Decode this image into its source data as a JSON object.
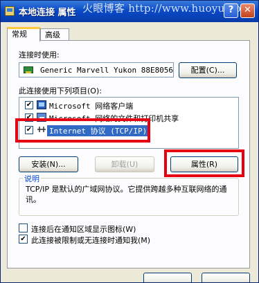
{
  "window": {
    "title": "本地连接 属性",
    "watermark": "火眼博客 http://www.huoyue.org"
  },
  "tabs": [
    {
      "label": "常规",
      "active": true
    },
    {
      "label": "高级",
      "active": false
    }
  ],
  "connect_using": {
    "label": "连接时使用:",
    "adapter": "Generic Marvell Yukon 88E8056",
    "configure_button": "配置(C)..."
  },
  "components": {
    "label": "此连接使用下列项目(O):",
    "items": [
      {
        "label": "Microsoft 网络客户端",
        "checked": true,
        "icon": "network-client-icon",
        "selected": false
      },
      {
        "label": "Microsoft 网络的文件和打印机共享",
        "checked": true,
        "icon": "file-printer-sharing-icon",
        "selected": false
      },
      {
        "label": "Internet 协议 (TCP/IP)",
        "checked": true,
        "icon": "protocol-icon",
        "selected": true
      }
    ]
  },
  "buttons": {
    "install": "安装(N)...",
    "uninstall": "卸载(U)",
    "properties": "属性(R)"
  },
  "description": {
    "title": "说明",
    "text": "TCP/IP 是默认的广域网协议。它提供跨越多种互联网络的通讯。"
  },
  "options": [
    {
      "label": "连接后在通知区域显示图标(W)",
      "checked": false
    },
    {
      "label": "此连接被限制或无连接时通知我(M)",
      "checked": true
    }
  ],
  "colors": {
    "highlight": "#e60012",
    "selection": "#316ac5",
    "titlebar": "#0a4bc7"
  }
}
